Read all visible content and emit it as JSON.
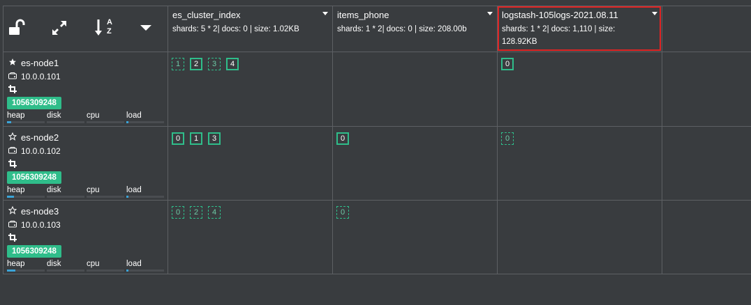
{
  "toolbar": {
    "icons": [
      "unlock-icon",
      "expand-icon",
      "sort-alpha-icon",
      "caret-down-icon"
    ],
    "sort_label_a": "A",
    "sort_label_z": "Z"
  },
  "indices": [
    {
      "name": "es_cluster_index",
      "stats": "shards: 5 * 2| docs: 0 | size: 1.02KB"
    },
    {
      "name": "items_phone",
      "stats": "shards: 1 * 2| docs: 0 | size: 208.00b"
    },
    {
      "name": "logstash-105logs-2021.08.11",
      "stats": "shards: 1 * 2| docs: 1,110 | size: 128.92KB"
    }
  ],
  "nodes": [
    {
      "name": "es-node1",
      "master": true,
      "ip": "10.0.0.101",
      "id": "1056309248",
      "metrics": [
        {
          "label": "heap",
          "value": 0.12
        },
        {
          "label": "disk",
          "value": 0.0
        },
        {
          "label": "cpu",
          "value": 0.0
        },
        {
          "label": "load",
          "value": 0.05
        }
      ],
      "shards": [
        [
          {
            "n": "1",
            "primary": false
          },
          {
            "n": "2",
            "primary": true
          },
          {
            "n": "3",
            "primary": false
          },
          {
            "n": "4",
            "primary": true
          }
        ],
        [],
        [
          {
            "n": "0",
            "primary": true
          }
        ]
      ]
    },
    {
      "name": "es-node2",
      "master": false,
      "ip": "10.0.0.102",
      "id": "1056309248",
      "metrics": [
        {
          "label": "heap",
          "value": 0.18
        },
        {
          "label": "disk",
          "value": 0.0
        },
        {
          "label": "cpu",
          "value": 0.0
        },
        {
          "label": "load",
          "value": 0.05
        }
      ],
      "shards": [
        [
          {
            "n": "0",
            "primary": true
          },
          {
            "n": "1",
            "primary": true
          },
          {
            "n": "3",
            "primary": true
          }
        ],
        [
          {
            "n": "0",
            "primary": true
          }
        ],
        [
          {
            "n": "0",
            "primary": false
          }
        ]
      ]
    },
    {
      "name": "es-node3",
      "master": false,
      "ip": "10.0.0.103",
      "id": "1056309248",
      "metrics": [
        {
          "label": "heap",
          "value": 0.22
        },
        {
          "label": "disk",
          "value": 0.0
        },
        {
          "label": "cpu",
          "value": 0.0
        },
        {
          "label": "load",
          "value": 0.05
        }
      ],
      "shards": [
        [
          {
            "n": "0",
            "primary": false
          },
          {
            "n": "2",
            "primary": false
          },
          {
            "n": "4",
            "primary": false
          }
        ],
        [
          {
            "n": "0",
            "primary": false
          }
        ],
        []
      ]
    }
  ],
  "colors": {
    "background": "#393c3f",
    "grid": "#5d6064",
    "accent": "#2fbd8a",
    "highlight": "#e02424",
    "metric": "#3ba4d8"
  }
}
